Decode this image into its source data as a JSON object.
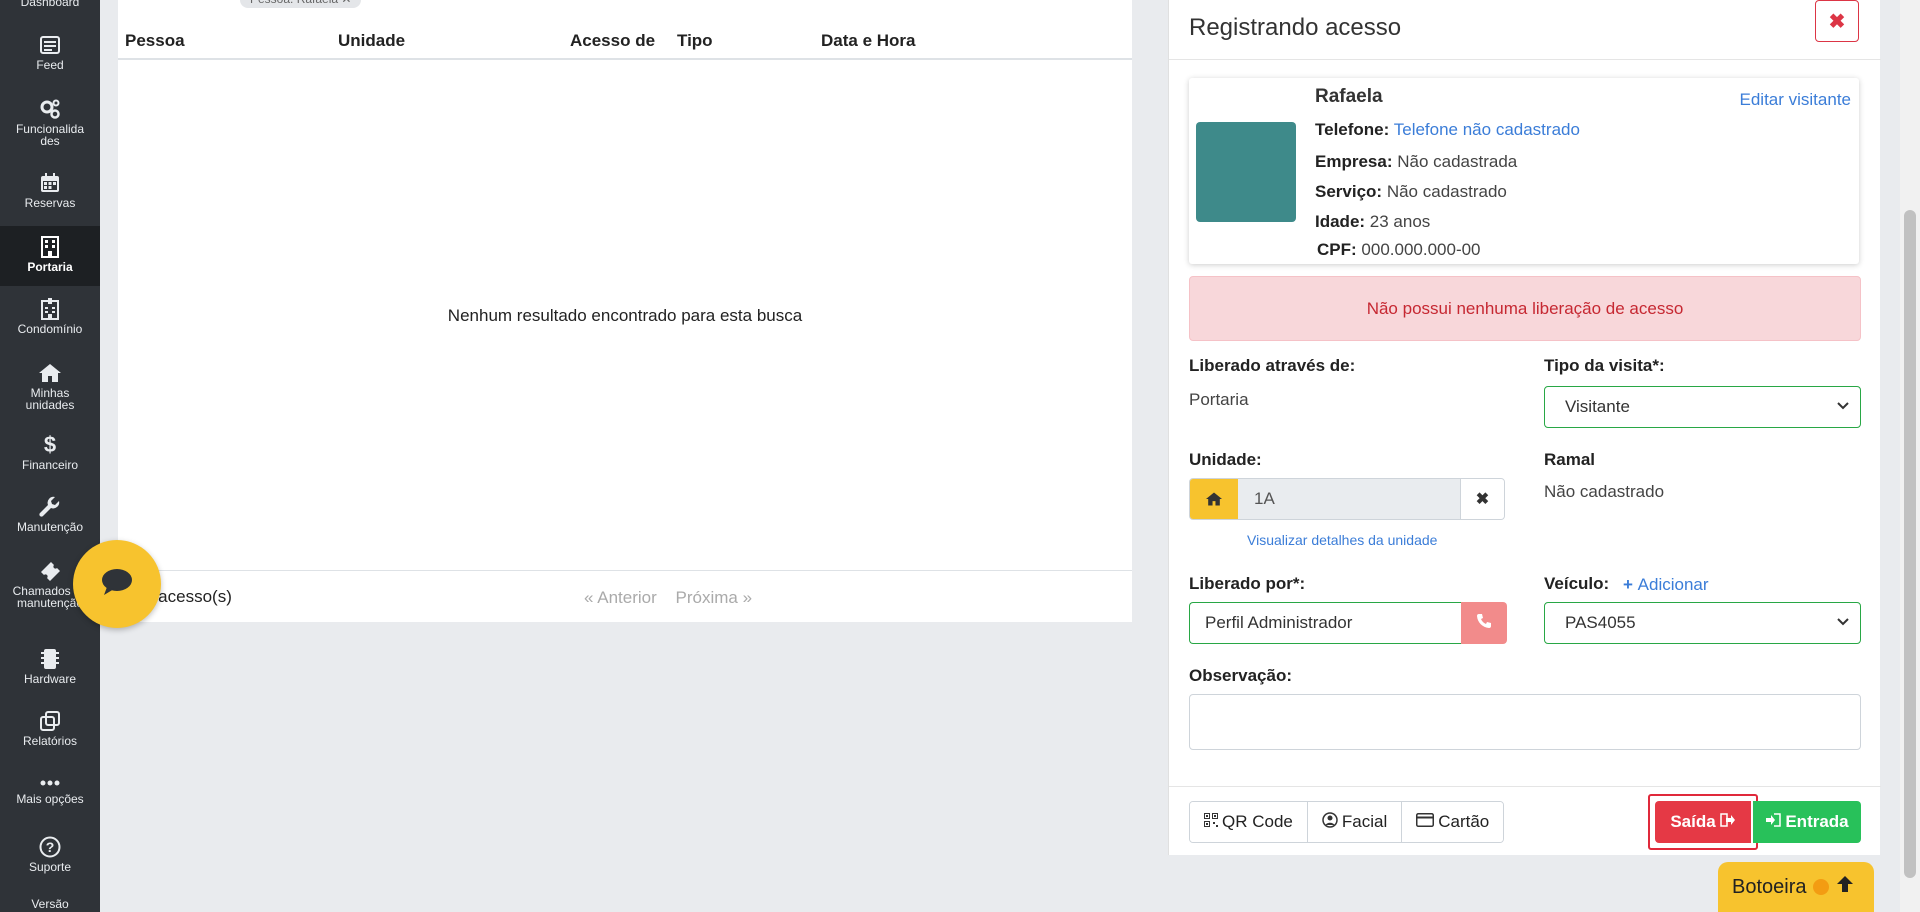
{
  "sidebar": {
    "items": [
      {
        "label": "Dashboard",
        "icon": "dashboard-icon"
      },
      {
        "label": "Feed",
        "icon": "feed-icon"
      },
      {
        "label": "Funcionalida des",
        "icon": "gears-icon"
      },
      {
        "label": "Reservas",
        "icon": "calendar-icon"
      },
      {
        "label": "Portaria",
        "icon": "building-icon"
      },
      {
        "label": "Condomínio",
        "icon": "hospital-building-icon"
      },
      {
        "label": "Minhas unidades",
        "icon": "home-icon"
      },
      {
        "label": "Financeiro",
        "icon": "dollar-icon"
      },
      {
        "label": "Manutenção",
        "icon": "wrench-icon"
      },
      {
        "label": "Chamados de manutenção",
        "icon": "ticket-icon"
      },
      {
        "label": "Hardware",
        "icon": "chip-icon"
      },
      {
        "label": "Relatórios",
        "icon": "copy-icon"
      },
      {
        "label": "Mais opções",
        "icon": "dots-icon"
      },
      {
        "label": "Suporte",
        "icon": "question-icon"
      },
      {
        "label": "Versão",
        "icon": ""
      }
    ],
    "active": "Portaria"
  },
  "table": {
    "filter_chip": "Pessoa: Rafaela ✕",
    "columns": [
      "Pessoa",
      "Unidade",
      "Acesso de",
      "Tipo",
      "Data e Hora"
    ],
    "empty_message": "Nenhum resultado encontrado para esta busca",
    "footer_count": "0 acesso(s)",
    "prev_label": "« Anterior",
    "next_label": "Próxima »"
  },
  "panel": {
    "title": "Registrando acesso",
    "close_label": "✖",
    "visitor": {
      "name": "Rafaela",
      "edit_label": "Editar visitante",
      "phone_label": "Telefone:",
      "phone_value": "Telefone não cadastrado",
      "company_label": "Empresa:",
      "company_value": "Não cadastrada",
      "service_label": "Serviço:",
      "service_value": "Não cadastrado",
      "age_label": "Idade:",
      "age_value": "23 anos",
      "cpf_label": "CPF:",
      "cpf_value": "000.000.000-00"
    },
    "alert": "Não possui nenhuma liberação de acesso",
    "released_via_label": "Liberado através de:",
    "released_via_value": "Portaria",
    "visit_type_label": "Tipo da visita*:",
    "visit_type_value": "Visitante",
    "unit_label": "Unidade:",
    "unit_value": "1A",
    "unit_details_link": "Visualizar detalhes da unidade",
    "ramal_label": "Ramal",
    "ramal_value": "Não cadastrado",
    "released_by_label": "Liberado por*:",
    "released_by_value": "Perfil Administrador",
    "vehicle_label": "Veículo:",
    "vehicle_add": "Adicionar",
    "vehicle_value": "PAS4055",
    "observation_label": "Observação:",
    "footer": {
      "qr_label": "QR Code",
      "facial_label": "Facial",
      "card_label": "Cartão",
      "exit_label": "Saída",
      "entry_label": "Entrada"
    }
  },
  "botoeira_label": "Botoeira",
  "colors": {
    "sidebar_bg": "#2f3338",
    "accent_yellow": "#f7c32e",
    "danger": "#e53945",
    "success": "#28c15a",
    "link": "#3b7dd8"
  }
}
